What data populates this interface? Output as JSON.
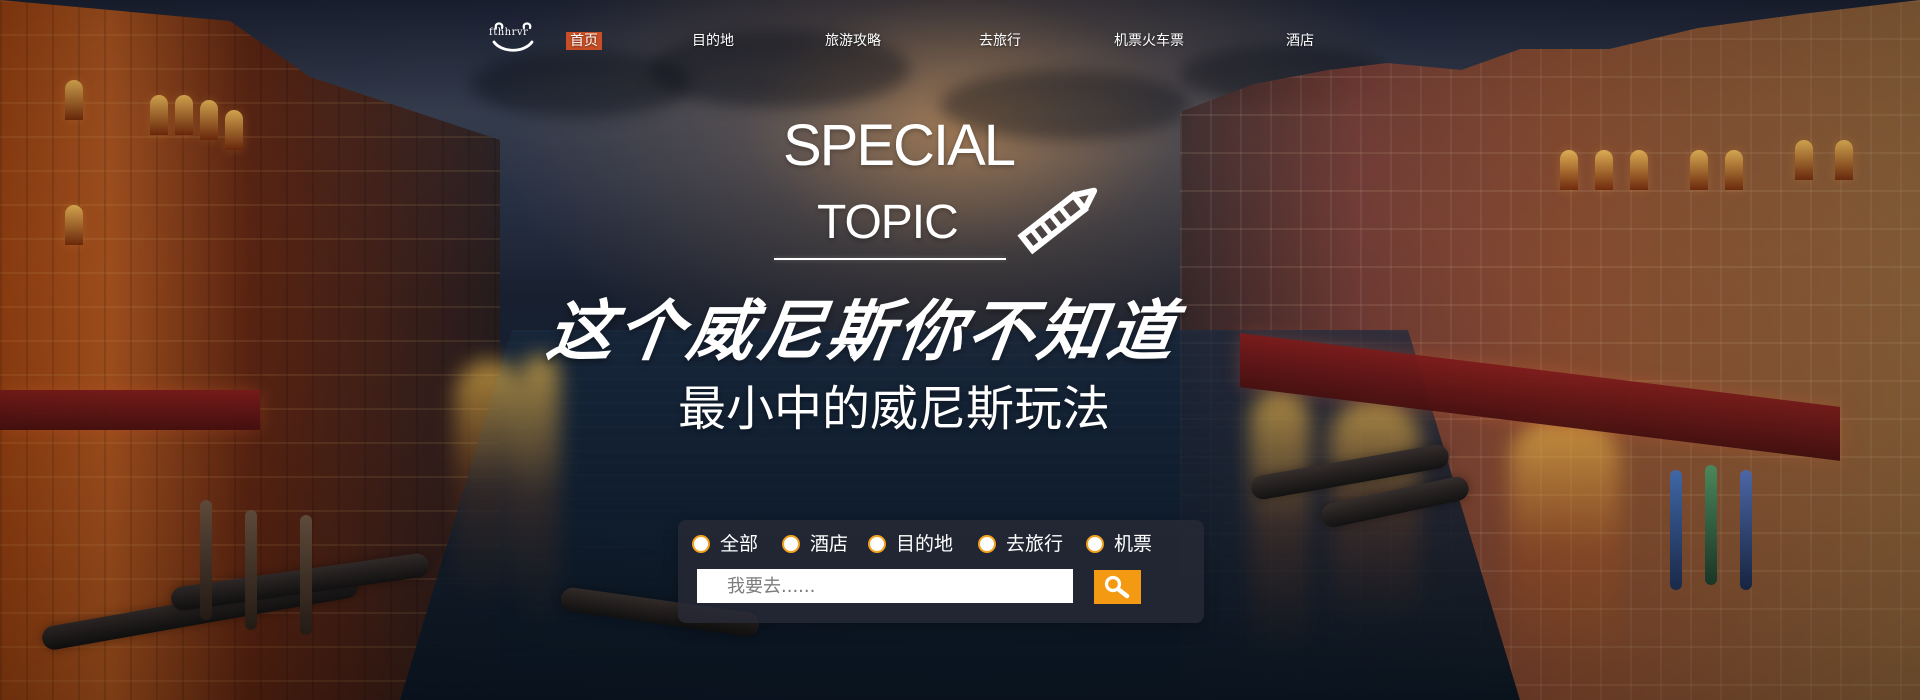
{
  "header": {
    "logo_text": "fthhrvr",
    "nav": [
      {
        "label": "首页",
        "active": true
      },
      {
        "label": "目的地",
        "active": false
      },
      {
        "label": "旅游攻略",
        "active": false
      },
      {
        "label": "去旅行",
        "active": false
      },
      {
        "label": "机票火车票",
        "active": false
      },
      {
        "label": "酒店",
        "active": false
      }
    ]
  },
  "hero": {
    "special_text": "SPECIAL",
    "topic_text": "TOPIC",
    "main_title": "这个威尼斯你不知道",
    "subtitle": "最小中的威尼斯玩法",
    "pencil_icon": "pencil-icon"
  },
  "search": {
    "options": [
      {
        "label": "全部"
      },
      {
        "label": "酒店"
      },
      {
        "label": "目的地"
      },
      {
        "label": "去旅行"
      },
      {
        "label": "机票"
      }
    ],
    "placeholder": "我要去......",
    "button_icon": "search-icon"
  },
  "colors": {
    "accent": "#f49a12",
    "active_nav": "#c94e25",
    "text": "#ffffff"
  }
}
